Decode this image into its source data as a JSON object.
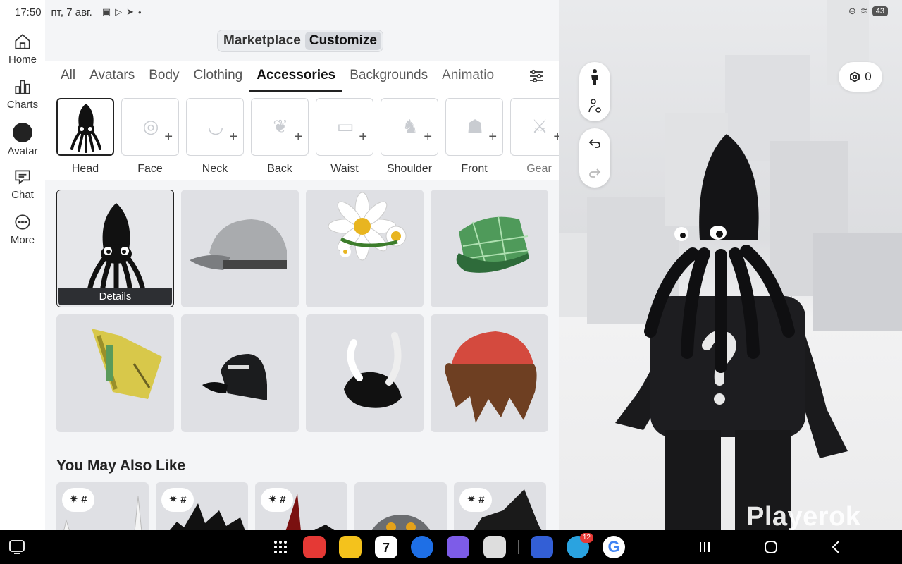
{
  "status_bar": {
    "time": "17:50",
    "date": "пт, 7 авг.",
    "battery": "43"
  },
  "nav": [
    {
      "label": "Home",
      "icon": "home-icon"
    },
    {
      "label": "Charts",
      "icon": "charts-icon"
    },
    {
      "label": "Avatar",
      "icon": "avatar-icon"
    },
    {
      "label": "Chat",
      "icon": "chat-icon"
    },
    {
      "label": "More",
      "icon": "more-icon"
    }
  ],
  "mode_switch": {
    "marketplace": "Marketplace",
    "customize": "Customize",
    "active": "Customize"
  },
  "tabs": [
    "All",
    "Avatars",
    "Body",
    "Clothing",
    "Accessories",
    "Backgrounds",
    "Animatio"
  ],
  "active_tab": "Accessories",
  "subcategories": [
    {
      "label": "Head",
      "icon": "squid-head-icon"
    },
    {
      "label": "Face",
      "icon": "glasses-icon"
    },
    {
      "label": "Neck",
      "icon": "necklace-icon"
    },
    {
      "label": "Back",
      "icon": "wings-icon"
    },
    {
      "label": "Waist",
      "icon": "belt-icon"
    },
    {
      "label": "Shoulder",
      "icon": "parrot-icon"
    },
    {
      "label": "Front",
      "icon": "bag-icon"
    },
    {
      "label": "Gear",
      "icon": "sword-icon"
    }
  ],
  "active_subcategory": "Head",
  "items": [
    {
      "name": "squid-hat",
      "selected": true,
      "details_label": "Details"
    },
    {
      "name": "silver-cap"
    },
    {
      "name": "daisy-crown"
    },
    {
      "name": "green-plaid-cap"
    },
    {
      "name": "yellow-tech-hat"
    },
    {
      "name": "roblox-black-cap"
    },
    {
      "name": "winged-black-hat"
    },
    {
      "name": "red-beanie-hair"
    }
  ],
  "recommendations": {
    "title": "You May Also Like",
    "badge": "✷ #",
    "count": 5
  },
  "scene": {
    "robux": "0",
    "watermark": "Playerok"
  },
  "dock": {
    "apps": [
      "app-drawer",
      "notes",
      "files",
      "calendar",
      "messages",
      "browser",
      "camera",
      "roblox",
      "telegram",
      "google"
    ],
    "calendar_day": "7",
    "telegram_badge": "12"
  }
}
